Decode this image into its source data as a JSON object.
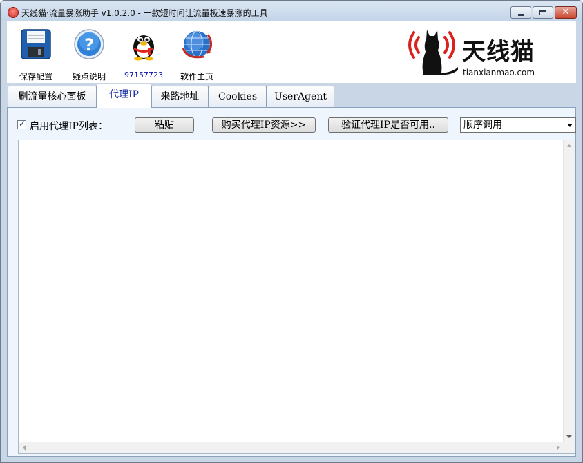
{
  "window": {
    "title": "天线猫·流量暴涨助手 v1.0.2.0 - 一款短时间让流量极速暴涨的工具",
    "icon": "app-icon",
    "controls": [
      "minimize-icon",
      "maximize-icon",
      "close-icon"
    ]
  },
  "toolbar": {
    "items": [
      {
        "label": "保存配置",
        "icon": "floppy-disk-icon"
      },
      {
        "label": "疑点说明",
        "icon": "help-icon"
      },
      {
        "label": "97157723",
        "icon": "qq-penguin-icon"
      },
      {
        "label": "软件主页",
        "icon": "globe-icon"
      }
    ]
  },
  "logo": {
    "name": "天线猫",
    "url": "tianxianmao.com",
    "icon": "cat-broadcast-logo-icon",
    "accent_color": "#d8231f"
  },
  "tabs": [
    {
      "label": "刷流量核心面板",
      "active": false
    },
    {
      "label": "代理IP",
      "active": true
    },
    {
      "label": "来路地址",
      "active": false
    },
    {
      "label": "Cookies",
      "active": false
    },
    {
      "label": "UserAgent",
      "active": false
    }
  ],
  "proxy_panel": {
    "enable_label": "启用代理IP列表：",
    "enable_checked": true,
    "paste_button": "粘贴",
    "buy_button": "购买代理IP资源>>",
    "verify_button": "验证代理IP是否可用..",
    "order_select": {
      "selected": "顺序调用"
    },
    "proxy_list": ""
  }
}
